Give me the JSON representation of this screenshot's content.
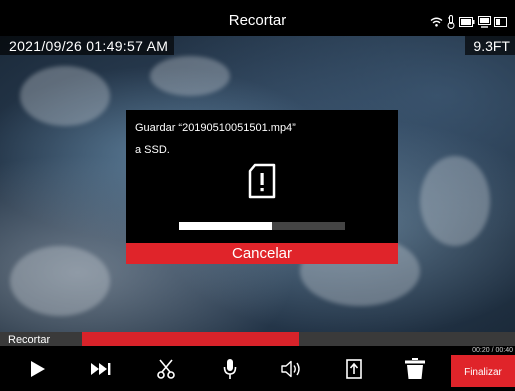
{
  "header": {
    "title": "Recortar",
    "status_icons": [
      "wifi-icon",
      "thermometer-icon",
      "battery-icon",
      "storage-icon",
      "card-icon"
    ]
  },
  "video": {
    "timestamp": "2021/09/26 01:49:57 AM",
    "distance": "9.3FT"
  },
  "dialog": {
    "message_line1": "Guardar “20190510051501.mp4”",
    "message_line2": "a SSD.",
    "icon": "file-alert-icon",
    "progress": 0.56,
    "cancel_label": "Cancelar"
  },
  "trim": {
    "label": "Recortar",
    "progress": 0.5,
    "time_readout": "00:20 / 00:40"
  },
  "toolbar": {
    "buttons": [
      "play-icon",
      "next-frame-icon",
      "scissors-icon",
      "microphone-icon",
      "speaker-icon",
      "export-icon",
      "trash-icon"
    ],
    "finalize_label": "Finalizar"
  },
  "colors": {
    "accent_red": "#e0242a",
    "bar_dark": "#3a3a3a"
  }
}
